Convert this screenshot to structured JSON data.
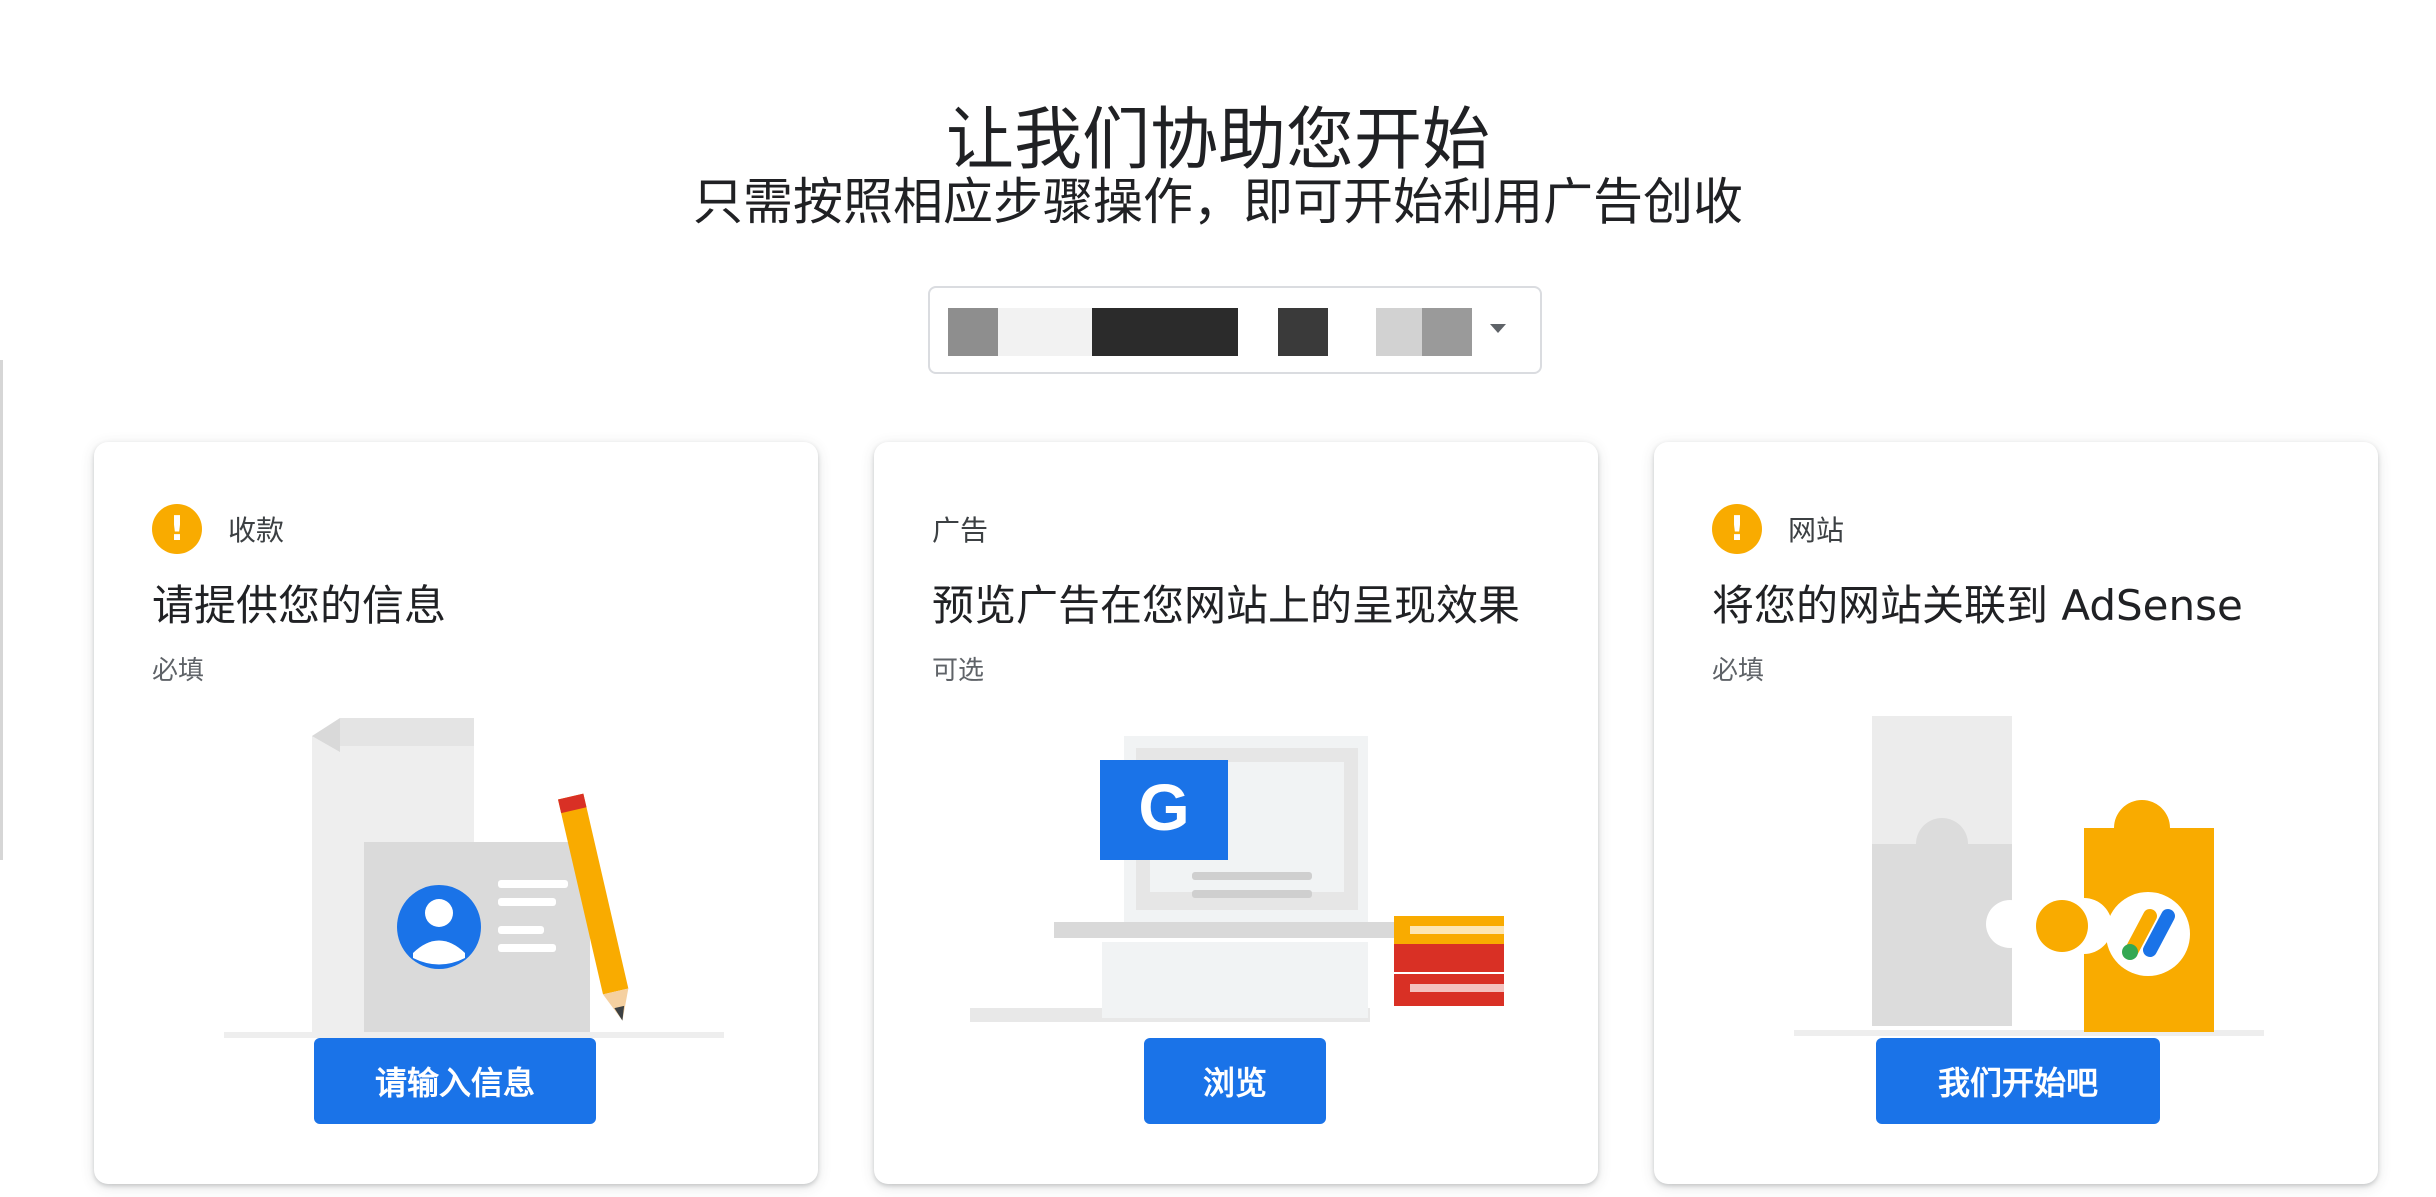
{
  "header": {
    "title": "让我们协助您开始",
    "subtitle": "只需按照相应步骤操作，即可开始利用广告创收"
  },
  "site_selector": {
    "value": ""
  },
  "cards": [
    {
      "label": "收款",
      "status": "warning",
      "title": "请提供您的信息",
      "note": "必填",
      "button": "请输入信息",
      "illustration": "profile-card-pencil"
    },
    {
      "label": "广告",
      "status": "none",
      "title": "预览广告在您网站上的呈现效果",
      "note": "可选",
      "button": "浏览",
      "illustration": "laptop-google-books"
    },
    {
      "label": "网站",
      "status": "warning",
      "title": "将您的网站关联到 AdSense",
      "note": "必填",
      "button": "我们开始吧",
      "illustration": "puzzle-adsense"
    }
  ],
  "colors": {
    "primary": "#1a73e8",
    "warning": "#f9ab00",
    "text": "#202124"
  }
}
